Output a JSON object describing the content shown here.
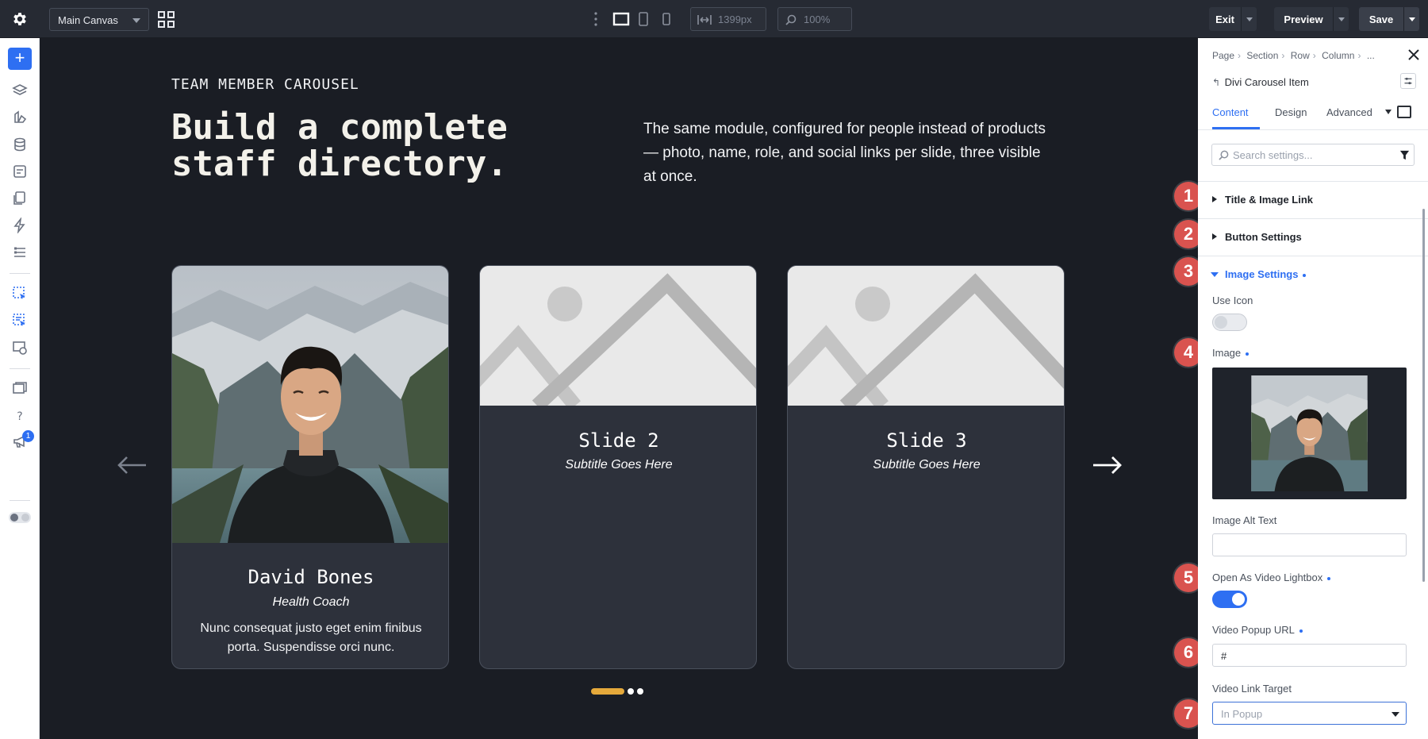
{
  "topbar": {
    "canvas_name": "Main Canvas",
    "width_value": "1399px",
    "zoom_value": "100%",
    "exit_label": "Exit",
    "preview_label": "Preview",
    "save_label": "Save"
  },
  "rail": {
    "add_label": "+",
    "notification_count": "1"
  },
  "canvas": {
    "eyebrow": "TEAM MEMBER CAROUSEL",
    "headline": "Build a complete staff directory.",
    "intro": "The same module, configured for people instead of products — photo, name, role, and social links per slide, three visible at once.",
    "cards": [
      {
        "title": "David Bones",
        "subtitle": "Health Coach",
        "body": "Nunc consequat justo eget enim finibus porta. Suspendisse orci nunc."
      },
      {
        "title": "Slide 2",
        "subtitle": "Subtitle Goes Here",
        "body": ""
      },
      {
        "title": "Slide 3",
        "subtitle": "Subtitle Goes Here",
        "body": ""
      }
    ],
    "pagination_active": 1,
    "pagination_count": 3
  },
  "markers": [
    "1",
    "2",
    "3",
    "4",
    "5",
    "6",
    "7"
  ],
  "panel": {
    "breadcrumb": [
      "Page",
      "Section",
      "Row",
      "Column",
      "..."
    ],
    "module_title": "Divi Carousel Item",
    "tabs": [
      "Content",
      "Design",
      "Advanced"
    ],
    "active_tab": "Content",
    "search_placeholder": "Search settings...",
    "sections": {
      "title_image_link": "Title & Image Link",
      "button_settings": "Button Settings",
      "image_settings": "Image Settings"
    },
    "fields": {
      "use_icon": {
        "label": "Use Icon",
        "on": false
      },
      "image": {
        "label": "Image"
      },
      "image_alt": {
        "label": "Image Alt Text",
        "value": ""
      },
      "video_lightbox": {
        "label": "Open As Video Lightbox",
        "on": true
      },
      "video_url": {
        "label": "Video Popup URL",
        "value": "#"
      },
      "video_target": {
        "label": "Video Link Target",
        "value": "In Popup"
      }
    }
  },
  "colors": {
    "accent_blue": "#2e6ff2",
    "marker_red": "#d9534f",
    "pagination_gold": "#e5a93b"
  }
}
